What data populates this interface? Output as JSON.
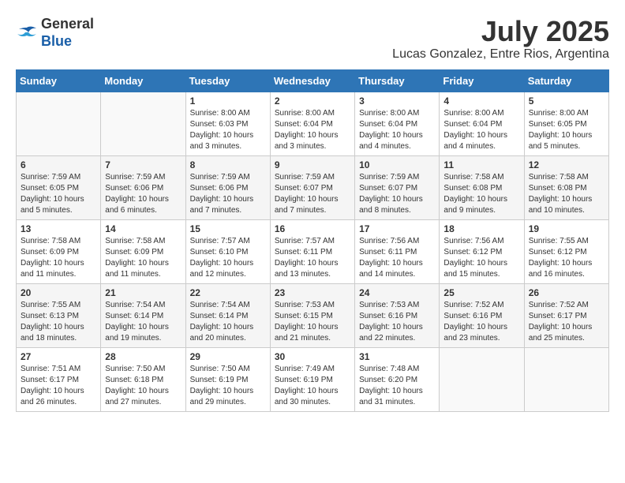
{
  "header": {
    "logo_general": "General",
    "logo_blue": "Blue",
    "month_year": "July 2025",
    "location": "Lucas Gonzalez, Entre Rios, Argentina"
  },
  "calendar": {
    "days_of_week": [
      "Sunday",
      "Monday",
      "Tuesday",
      "Wednesday",
      "Thursday",
      "Friday",
      "Saturday"
    ],
    "weeks": [
      [
        {
          "day": "",
          "info": ""
        },
        {
          "day": "",
          "info": ""
        },
        {
          "day": "1",
          "info": "Sunrise: 8:00 AM\nSunset: 6:03 PM\nDaylight: 10 hours and 3 minutes."
        },
        {
          "day": "2",
          "info": "Sunrise: 8:00 AM\nSunset: 6:04 PM\nDaylight: 10 hours and 3 minutes."
        },
        {
          "day": "3",
          "info": "Sunrise: 8:00 AM\nSunset: 6:04 PM\nDaylight: 10 hours and 4 minutes."
        },
        {
          "day": "4",
          "info": "Sunrise: 8:00 AM\nSunset: 6:04 PM\nDaylight: 10 hours and 4 minutes."
        },
        {
          "day": "5",
          "info": "Sunrise: 8:00 AM\nSunset: 6:05 PM\nDaylight: 10 hours and 5 minutes."
        }
      ],
      [
        {
          "day": "6",
          "info": "Sunrise: 7:59 AM\nSunset: 6:05 PM\nDaylight: 10 hours and 5 minutes."
        },
        {
          "day": "7",
          "info": "Sunrise: 7:59 AM\nSunset: 6:06 PM\nDaylight: 10 hours and 6 minutes."
        },
        {
          "day": "8",
          "info": "Sunrise: 7:59 AM\nSunset: 6:06 PM\nDaylight: 10 hours and 7 minutes."
        },
        {
          "day": "9",
          "info": "Sunrise: 7:59 AM\nSunset: 6:07 PM\nDaylight: 10 hours and 7 minutes."
        },
        {
          "day": "10",
          "info": "Sunrise: 7:59 AM\nSunset: 6:07 PM\nDaylight: 10 hours and 8 minutes."
        },
        {
          "day": "11",
          "info": "Sunrise: 7:58 AM\nSunset: 6:08 PM\nDaylight: 10 hours and 9 minutes."
        },
        {
          "day": "12",
          "info": "Sunrise: 7:58 AM\nSunset: 6:08 PM\nDaylight: 10 hours and 10 minutes."
        }
      ],
      [
        {
          "day": "13",
          "info": "Sunrise: 7:58 AM\nSunset: 6:09 PM\nDaylight: 10 hours and 11 minutes."
        },
        {
          "day": "14",
          "info": "Sunrise: 7:58 AM\nSunset: 6:09 PM\nDaylight: 10 hours and 11 minutes."
        },
        {
          "day": "15",
          "info": "Sunrise: 7:57 AM\nSunset: 6:10 PM\nDaylight: 10 hours and 12 minutes."
        },
        {
          "day": "16",
          "info": "Sunrise: 7:57 AM\nSunset: 6:11 PM\nDaylight: 10 hours and 13 minutes."
        },
        {
          "day": "17",
          "info": "Sunrise: 7:56 AM\nSunset: 6:11 PM\nDaylight: 10 hours and 14 minutes."
        },
        {
          "day": "18",
          "info": "Sunrise: 7:56 AM\nSunset: 6:12 PM\nDaylight: 10 hours and 15 minutes."
        },
        {
          "day": "19",
          "info": "Sunrise: 7:55 AM\nSunset: 6:12 PM\nDaylight: 10 hours and 16 minutes."
        }
      ],
      [
        {
          "day": "20",
          "info": "Sunrise: 7:55 AM\nSunset: 6:13 PM\nDaylight: 10 hours and 18 minutes."
        },
        {
          "day": "21",
          "info": "Sunrise: 7:54 AM\nSunset: 6:14 PM\nDaylight: 10 hours and 19 minutes."
        },
        {
          "day": "22",
          "info": "Sunrise: 7:54 AM\nSunset: 6:14 PM\nDaylight: 10 hours and 20 minutes."
        },
        {
          "day": "23",
          "info": "Sunrise: 7:53 AM\nSunset: 6:15 PM\nDaylight: 10 hours and 21 minutes."
        },
        {
          "day": "24",
          "info": "Sunrise: 7:53 AM\nSunset: 6:16 PM\nDaylight: 10 hours and 22 minutes."
        },
        {
          "day": "25",
          "info": "Sunrise: 7:52 AM\nSunset: 6:16 PM\nDaylight: 10 hours and 23 minutes."
        },
        {
          "day": "26",
          "info": "Sunrise: 7:52 AM\nSunset: 6:17 PM\nDaylight: 10 hours and 25 minutes."
        }
      ],
      [
        {
          "day": "27",
          "info": "Sunrise: 7:51 AM\nSunset: 6:17 PM\nDaylight: 10 hours and 26 minutes."
        },
        {
          "day": "28",
          "info": "Sunrise: 7:50 AM\nSunset: 6:18 PM\nDaylight: 10 hours and 27 minutes."
        },
        {
          "day": "29",
          "info": "Sunrise: 7:50 AM\nSunset: 6:19 PM\nDaylight: 10 hours and 29 minutes."
        },
        {
          "day": "30",
          "info": "Sunrise: 7:49 AM\nSunset: 6:19 PM\nDaylight: 10 hours and 30 minutes."
        },
        {
          "day": "31",
          "info": "Sunrise: 7:48 AM\nSunset: 6:20 PM\nDaylight: 10 hours and 31 minutes."
        },
        {
          "day": "",
          "info": ""
        },
        {
          "day": "",
          "info": ""
        }
      ]
    ]
  }
}
